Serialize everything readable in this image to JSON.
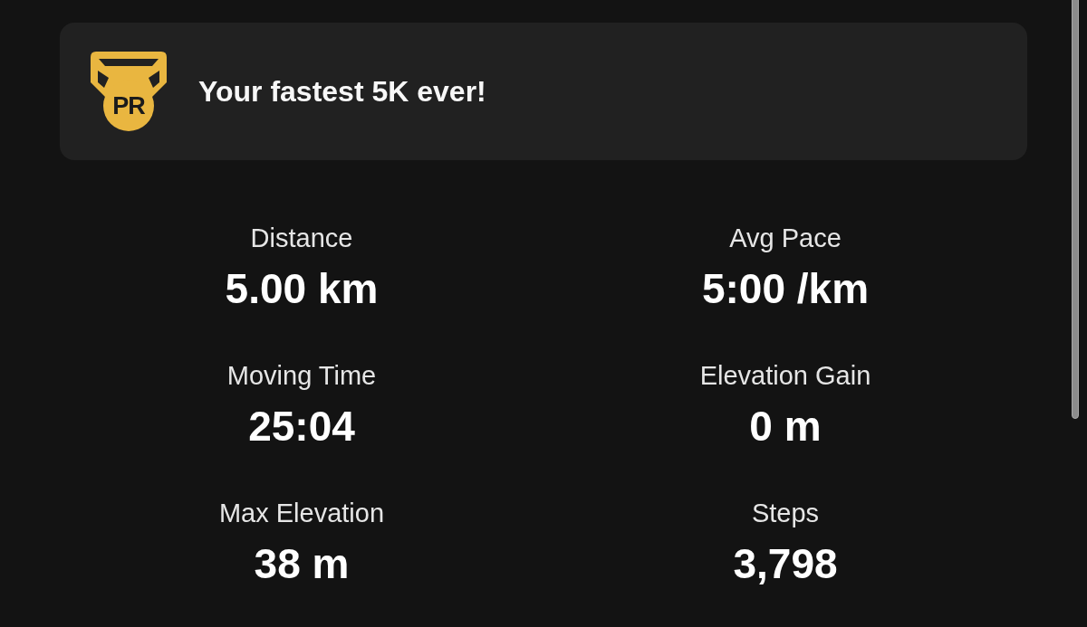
{
  "banner": {
    "badge": "PR",
    "message": "Your fastest 5K ever!"
  },
  "stats": [
    {
      "label": "Distance",
      "value": "5.00 km"
    },
    {
      "label": "Avg Pace",
      "value": "5:00 /km"
    },
    {
      "label": "Moving Time",
      "value": "25:04"
    },
    {
      "label": "Elevation Gain",
      "value": "0 m"
    },
    {
      "label": "Max Elevation",
      "value": "38 m"
    },
    {
      "label": "Steps",
      "value": "3,798"
    }
  ]
}
